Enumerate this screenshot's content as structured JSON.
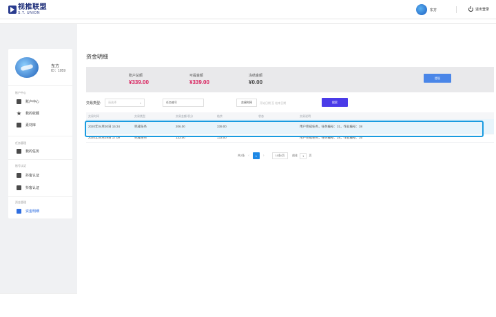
{
  "header": {
    "logo_cn": "视推联盟",
    "logo_en": "S.T. UNION",
    "user_name": "东方",
    "logout_label": "退出登录"
  },
  "sidebar": {
    "profile": {
      "name": "东方",
      "id": "ID：1059"
    },
    "groups": [
      {
        "label": "账户中心",
        "items": [
          {
            "label": "账户中心",
            "icon": "drawer-icon"
          },
          {
            "label": "我的收藏",
            "icon": "star-icon"
          },
          {
            "label": "素材库",
            "icon": "image-icon"
          }
        ]
      },
      {
        "label": "任务管理",
        "items": [
          {
            "label": "我的任务",
            "icon": "clipboard-icon"
          }
        ]
      },
      {
        "label": "账号认证",
        "items": [
          {
            "label": "抖客认证",
            "icon": "camera-icon"
          },
          {
            "label": "抖客认证",
            "icon": "tiktok-icon"
          }
        ]
      },
      {
        "label": "资金管理",
        "items": [
          {
            "label": "资金明细",
            "icon": "wallet-icon"
          }
        ]
      }
    ]
  },
  "main": {
    "title": "资金明细",
    "summary": {
      "total_label": "账户总额",
      "total_value": "¥339.00",
      "available_label": "可提金额",
      "available_value": "¥339.00",
      "frozen_label": "冻结金额",
      "frozen_value": "¥0.00",
      "withdraw_label": "提现"
    },
    "filters": {
      "type_label": "交易类型:",
      "type_placeholder": "请选择",
      "task_placeholder": "任务编号",
      "date_button": "交易时间",
      "date_range": "开始日期  至  结束日期",
      "search_label": "搜索"
    },
    "table": {
      "headers": [
        "交易时间",
        "交易类型",
        "交易金额/积分",
        "结余",
        "状态",
        "交易说明"
      ],
      "rows": [
        [
          "2020年04月30日 15:34",
          "完成任务",
          "206.00",
          "339.00",
          "",
          "用户完成任务，任务编号：31，作业编号：38"
        ],
        [
          "2020年04月29日 17:09",
          "完成任务",
          "133.00",
          "133.00",
          "",
          "用户完成任务，任务编号：28，作业编号：35"
        ]
      ]
    },
    "pagination": {
      "total": "共2条",
      "current": "1",
      "page_size": "10条/页",
      "goto_label": "前往",
      "goto_value": "1",
      "goto_suffix": "页"
    }
  },
  "colors": {
    "accent": "#4a3be8",
    "money": "#d81e5b",
    "highlight_border": "#1a9be0"
  }
}
